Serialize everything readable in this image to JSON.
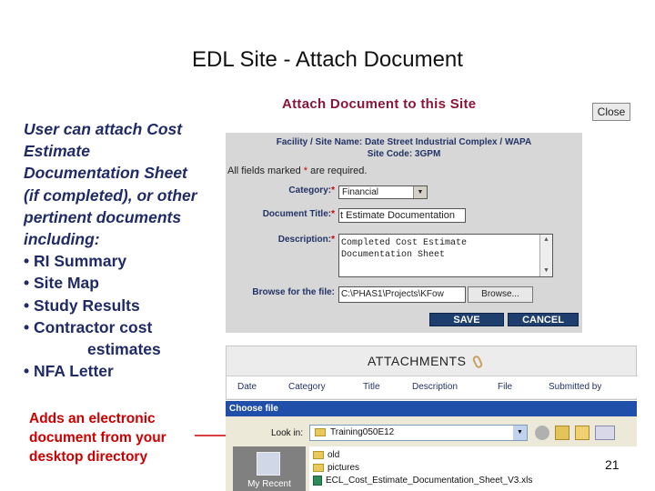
{
  "slide": {
    "title": "EDL Site -  Attach Document",
    "page_number": "21"
  },
  "bullets": {
    "intro": [
      "User can attach Cost",
      "Estimate",
      "Documentation Sheet",
      "(if completed), or other",
      "pertinent documents",
      "including:"
    ],
    "items": [
      "• RI Summary",
      "• Site Map",
      "• Study Results",
      "• Contractor cost",
      "estimates",
      "• NFA Letter"
    ]
  },
  "note": {
    "lines": [
      "Adds an electronic",
      "document from your",
      "desktop directory"
    ]
  },
  "dialog": {
    "heading": "Attach Document to this Site",
    "close_label": "Close",
    "facility_line": "Facility / Site Name: Date Street Industrial Complex / WAPA",
    "site_code_line": "Site Code: 3GPM",
    "required_note_prefix": "All fields marked ",
    "required_note_star": "*",
    "required_note_suffix": " are required.",
    "category_label": "Category:",
    "category_value": "Financial",
    "doc_title_label": "Document Title:",
    "doc_title_value": "t Estimate Documentation",
    "description_label": "Description:",
    "description_line1": "Completed Cost Estimate",
    "description_line2": "Documentation Sheet",
    "browse_label": "Browse for the file:",
    "browse_value": "C:\\PHAS1\\Projects\\KFow",
    "browse_button": "Browse...",
    "save_button": "SAVE",
    "cancel_button": "CANCEL",
    "star": "*"
  },
  "attachments": {
    "title": "ATTACHMENTS",
    "columns": [
      "Date",
      "Category",
      "Title",
      "Description",
      "File",
      "Submitted by"
    ]
  },
  "choose_file": {
    "title": "Choose file",
    "look_in_label": "Look in:",
    "look_in_value": "Training050E12",
    "recent_label": "My Recent",
    "files": [
      "old",
      "pictures",
      "ECL_Cost_Estimate_Documentation_Sheet_V3.xls"
    ]
  },
  "colors": {
    "bullet_text": "#1f2a66",
    "note_text": "#cc0000",
    "dialog_heading": "#8b1538",
    "button_dark": "#1e3f6e"
  }
}
